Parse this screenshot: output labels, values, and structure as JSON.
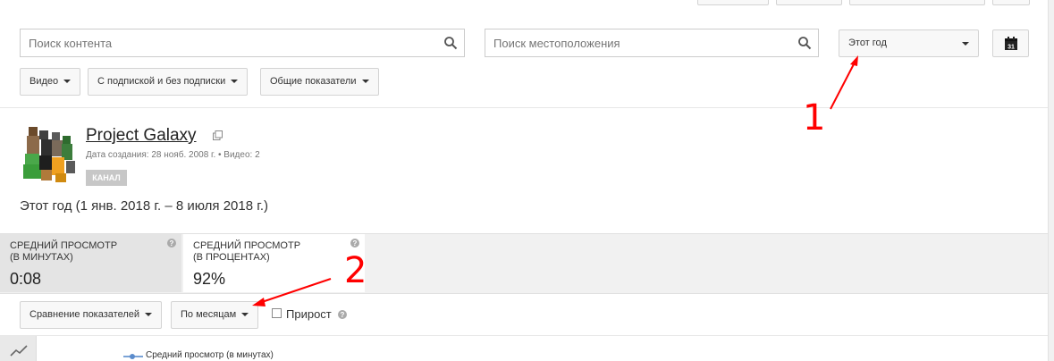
{
  "search": {
    "content_placeholder": "Поиск контента",
    "location_placeholder": "Поиск местоположения"
  },
  "period_select": {
    "value": "Этот год"
  },
  "calendar": {
    "day": "31"
  },
  "filters": {
    "content_type": "Видео",
    "subscription": "С подпиской и без подписки",
    "metrics": "Общие показатели"
  },
  "channel": {
    "name": "Project Galaxy",
    "meta": "Дата создания: 28 нояб. 2008 г. • Видео: 2",
    "badge": "КАНАЛ"
  },
  "date_range": "Этот год (1 янв. 2018 г. – 8 июля 2018 г.)",
  "metrics": [
    {
      "label_line1": "СРЕДНИЙ ПРОСМОТР",
      "label_line2": "(В МИНУТАХ)",
      "value": "0:08",
      "selected": true
    },
    {
      "label_line1": "СРЕДНИЙ ПРОСМОТР",
      "label_line2": "(В ПРОЦЕНТАХ)",
      "value": "92%",
      "selected": false
    }
  ],
  "toolbar": {
    "compare_button": "Сравнение показателей",
    "period_button": "По месяцам",
    "growth_label": "Прирост",
    "growth_checked": false
  },
  "legend": {
    "series_label": "Средний просмотр (в минутах)",
    "series_color": "#5b8ccc"
  },
  "annotations": {
    "marker_1": "1",
    "marker_2": "2",
    "color": "#ff0000"
  },
  "icons": [
    "search-icon",
    "chevron-down-icon",
    "calendar-icon",
    "external-link-icon",
    "help-icon",
    "line-chart-icon"
  ]
}
